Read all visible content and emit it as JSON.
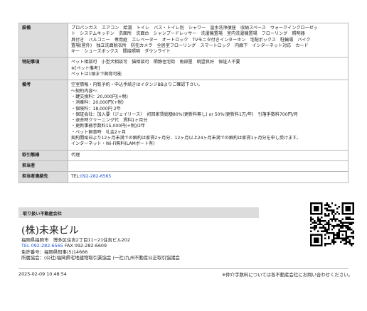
{
  "rows": [
    {
      "label": "設備",
      "lines": [
        "プロパンガス　エアコン　給湯　トイレ　バス・トイレ別　シャワー　温水洗浄便座　収納スペース　ウォークインクローゼッ",
        "ト　システムキッチン　洗面所　洗面台　シャンプードレッサー　洗濯機置場　室内洗濯機置場　フローリング　照明器",
        "具付き　バルコニー　専用庭　エレベーター　オートロック　TVモニタ付きインターホン　宅配ボックス　駐輪場　バイク",
        "置場(屋外)　独立洗面脱衣所　防犯カメラ　全居室フローリング　スマートロック　内廊下　インターネット対応　カード",
        "キー　シューズボックス　間接照明　ダウンライト"
      ]
    },
    {
      "label": "特記事項",
      "lines": [
        "ペット相談可　小型犬相談可　猫相談可　閑静住宅街　角部屋　眺望良好　保証人不要",
        "※[ペット備考]",
        "ペットは1頭まで飼育可能"
      ]
    },
    {
      "label": "備考",
      "lines": [
        "空室情報・内覧予約・申込手続きはイタンジBBよりご確認下さい。",
        "～契約内容～",
        "・鍵交換料：20,000円(+税)",
        "・消毒料：20,000円(+税)",
        "・保険料：18,000円 2年",
        "・保証会社：加入要（ジェイリース）　初回家賃総額80%(更新料無し) or 50%(更新料1万/年)　引落手数料700円/月",
        "・退去時クリーニング代　賃料1ヶ月分",
        "・更新事務手数料15,000円(+税)/2年",
        "・ペット飼育時　礼金2ヶ月",
        "契約開始日より12ヶ月未満での解約は家賃2ヶ月分、12ヶ月以上24ヶ月未満での解約は家賃1ヶ月分を申し受けます。",
        "インターネット・Wi-Fi無料(LAMボート有)"
      ]
    },
    {
      "label": "取引態様",
      "lines": [
        "代理"
      ]
    },
    {
      "label": "担当者",
      "lines": [
        ""
      ]
    },
    {
      "label": "担当者連絡先",
      "lines": [],
      "tel_prefix": "TEL:",
      "tel_value": "092-282-6565"
    }
  ],
  "company": {
    "section_title": "取り扱い不動産会社",
    "name": "(株)未来ビル",
    "address": "福岡県福岡市　博多区住吉2丁目11−21住吉ビル202",
    "tel_label": "TEL",
    "tel_value": "092-282-6565",
    "fax_text": "FAX 092-282-6609",
    "license": "免許番号：福岡県知事(5)14666",
    "association": "所属協会：(公社)福岡県宅地建物取引業協会 (一社)九州不動産公正取引協議会"
  },
  "footer": {
    "timestamp": "2025-02-09 10:48:54",
    "note": "※仲介手数料については各不動産会社にお問い合わせください。"
  },
  "qr": {
    "icon": "qr-code-icon"
  }
}
